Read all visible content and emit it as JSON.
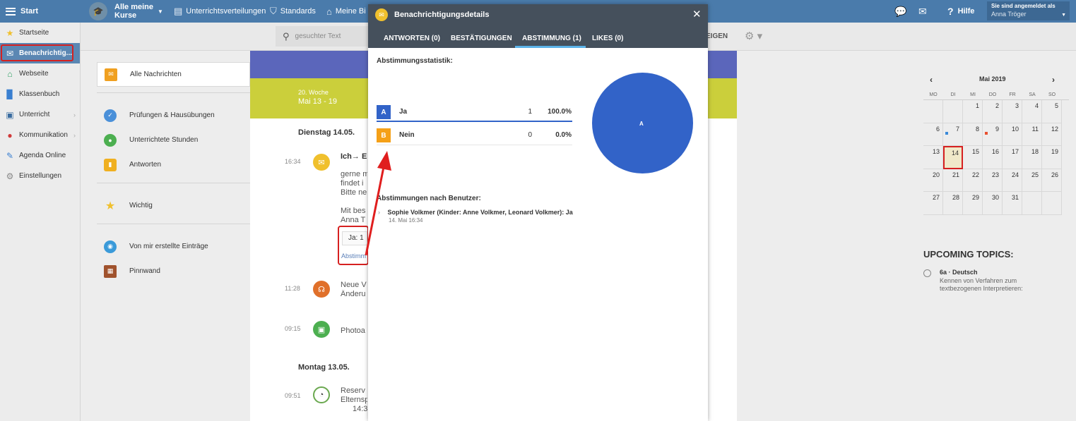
{
  "topbar": {
    "start": "Start",
    "courses_line1": "Alle meine",
    "courses_line2": "Kurse",
    "nav1": "Unterrichtsverteilungen",
    "nav2": "Standards",
    "nav3": "Meine Bi",
    "help": "Hilfe",
    "login_label": "Sie sind angemeldet als",
    "login_user": "Anna Tröger"
  },
  "sidebar": {
    "items": [
      {
        "label": "Startseite"
      },
      {
        "label": "Benachrichtig..."
      },
      {
        "label": "Webseite"
      },
      {
        "label": "Klassenbuch"
      },
      {
        "label": "Unterricht"
      },
      {
        "label": "Kommunikation"
      },
      {
        "label": "Agenda Online"
      },
      {
        "label": "Einstellungen"
      }
    ]
  },
  "subbar": {
    "search_placeholder": "gesuchter Text",
    "partial_text": "EIGEN"
  },
  "categories": [
    {
      "label": "Alle Nachrichten",
      "color": "#f0a020"
    },
    {
      "label": "Prüfungen & Hausübungen",
      "color": "#4a90d9"
    },
    {
      "label": "Unterrichtete Stunden",
      "color": "#4caf50"
    },
    {
      "label": "Antworten",
      "color": "#f0b020"
    },
    {
      "label": "Wichtig",
      "color": "#f0c02d"
    },
    {
      "label": "Von mir erstellte Einträge",
      "color": "#3a9ad9"
    },
    {
      "label": "Pinnwand",
      "color": "#a0522d"
    }
  ],
  "feed": {
    "week_label": "20. Woche",
    "week_range": "Mai 13 - 19",
    "day1": "Dienstag 14.05.",
    "day2": "Montag 13.05.",
    "msg1_time": "16:34",
    "msg1_title": "Ich→ E",
    "msg1_line1": "gerne m",
    "msg1_line2": "findet i",
    "msg1_line3": "Bitte ne",
    "msg1_line4": "Mit bes",
    "msg1_line5": "Anna T",
    "msg1_vote": "Ja: 1",
    "msg1_vote_link": "Abstimm",
    "msg2_time": "11:28",
    "msg2_line1": "Neue V",
    "msg2_line2": "Änderu",
    "msg3_time": "09:15",
    "msg3_line1": "Photoa",
    "msg4_time": "09:51",
    "msg4_line1": "Reserv",
    "msg4_line2": "Elternsp",
    "msg4_line3": "14:3"
  },
  "modal": {
    "title": "Benachrichtigungsdetails",
    "tabs": [
      "ANTWORTEN (0)",
      "BESTÄTIGUNGEN",
      "ABSTIMMUNG (1)",
      "LIKES (0)"
    ],
    "active_tab": 2,
    "stats_title": "Abstimmungsstatistik:",
    "options": [
      {
        "letter": "A",
        "label": "Ja",
        "count": "1",
        "percent": "100.0%",
        "color": "#3263c8"
      },
      {
        "letter": "B",
        "label": "Nein",
        "count": "0",
        "percent": "0.0%",
        "color": "#f5a017"
      }
    ],
    "pie_label": "A",
    "pie_share_a": 1.0,
    "by_user_title": "Abstimmungen nach Benutzer:",
    "user_vote": "Sophie Volkmer (Kinder: Anne Volkmer, Leonard Volkmer): Ja",
    "user_vote_time": "14. Mai 16:34"
  },
  "calendar": {
    "title": "Mai 2019",
    "weekdays": [
      "MO",
      "DI",
      "MI",
      "DO",
      "FR",
      "SA",
      "SO"
    ],
    "weeks": [
      [
        "",
        "",
        "1",
        "2",
        "3",
        "4",
        "5"
      ],
      [
        "6",
        "7",
        "8",
        "9",
        "10",
        "11",
        "12"
      ],
      [
        "13",
        "14",
        "15",
        "16",
        "17",
        "18",
        "19"
      ],
      [
        "20",
        "21",
        "22",
        "23",
        "24",
        "25",
        "26"
      ],
      [
        "27",
        "28",
        "29",
        "30",
        "31",
        "",
        ""
      ]
    ],
    "today": "14",
    "dots": [
      {
        "day": "7",
        "color": "#3a8ad9"
      },
      {
        "day": "9",
        "color": "#e85030"
      }
    ]
  },
  "upcoming": {
    "title": "UPCOMING TOPICS:",
    "subject": "6a · Deutsch",
    "desc": "Kennen von Verfahren zum textbezogenen Interpretieren:"
  },
  "colors": {
    "topbar": "#4a7bab",
    "accent_red": "#d62020",
    "modal_header": "#45505c"
  }
}
